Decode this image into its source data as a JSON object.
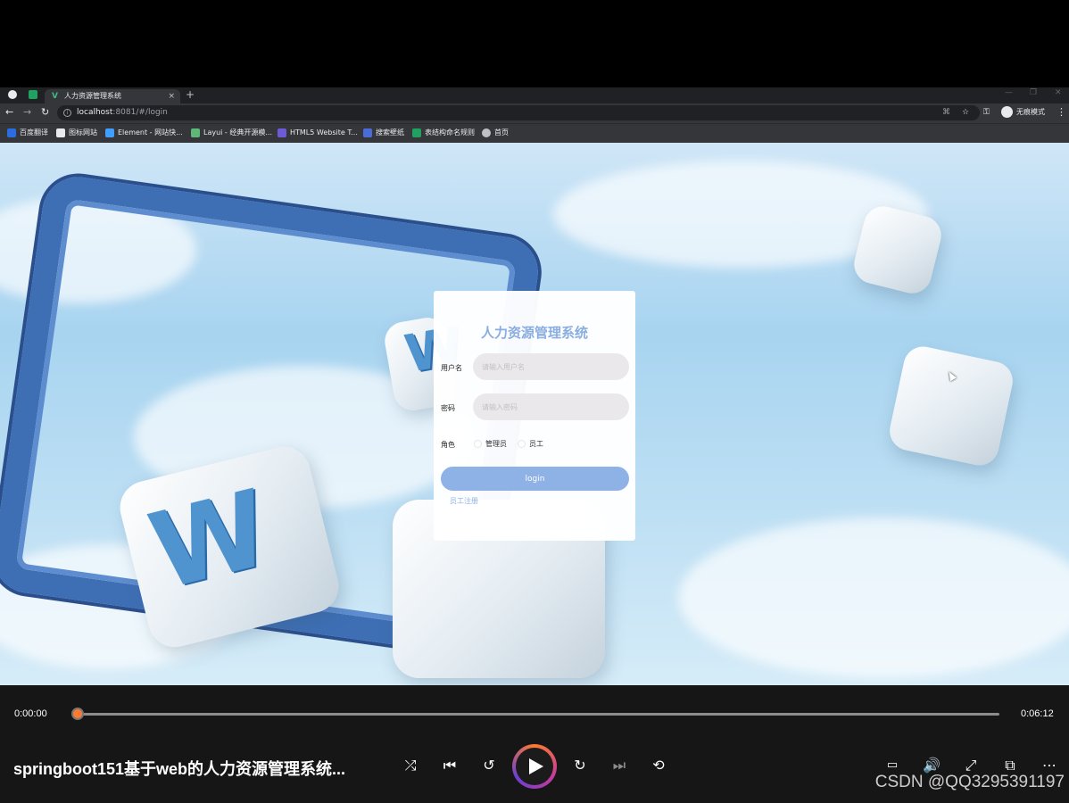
{
  "browser": {
    "tab_title": "人力资源管理系统",
    "tab_close": "×",
    "new_tab": "+",
    "url_host": "localhost",
    "url_path": ":8081/#/login",
    "profile_label": "无痕模式",
    "bookmarks": [
      {
        "label": "百度翻译",
        "color": "#2b6de0"
      },
      {
        "label": "图标网站",
        "color": "#e8eaed"
      },
      {
        "label": "Element - 网站快...",
        "color": "#409eff"
      },
      {
        "label": "Layui - 经典开源模...",
        "color": "#5fb878"
      },
      {
        "label": "HTML5 Website T...",
        "color": "#6b5bd6"
      },
      {
        "label": "搜索壁纸",
        "color": "#4a6cd8"
      },
      {
        "label": "表结构命名规则",
        "color": "#20a162"
      },
      {
        "label": "首页",
        "color": "#bdc1c6"
      }
    ]
  },
  "login": {
    "title": "人力资源管理系统",
    "username_label": "用户名",
    "username_placeholder": "请输入用户名",
    "password_label": "密码",
    "password_placeholder": "请输入密码",
    "role_label": "角色",
    "roles": [
      "管理员",
      "员工"
    ],
    "login_button": "login",
    "register_link": "员工注册"
  },
  "player": {
    "current_time": "0:00:00",
    "total_time": "0:06:12",
    "progress": 0,
    "video_title": "springboot151基于web的人力资源管理系统...",
    "watermark": "CSDN @QQ3295391197",
    "accent_color": "#ff7a2e"
  }
}
